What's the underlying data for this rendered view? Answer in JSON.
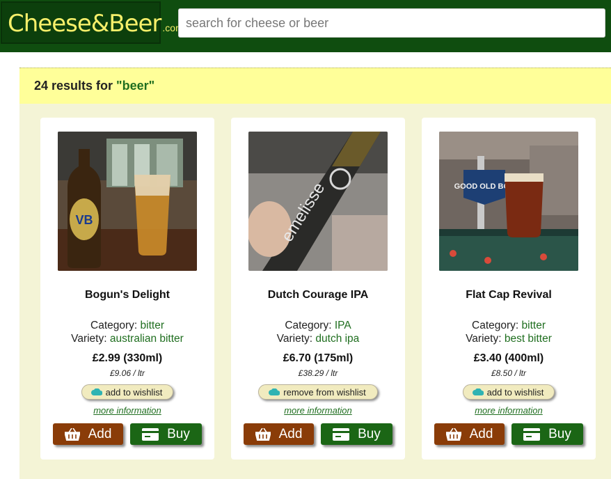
{
  "header": {
    "logo_text": "Cheese&Beer",
    "logo_suffix": ".com",
    "search_placeholder": "search for cheese or beer"
  },
  "results": {
    "text": "24 results for",
    "query": "\"beer\""
  },
  "labels": {
    "category": "Category:",
    "variety": "Variety:",
    "more_info": "more information",
    "add": "Add",
    "buy": "Buy"
  },
  "products": [
    {
      "name": "Bogun's Delight",
      "category": "bitter",
      "variety": "australian bitter",
      "price": "£2.99 (330ml)",
      "unit_price": "£9.06 / ltr",
      "wishlist_label": "add to wishlist",
      "bottle_label": "VB"
    },
    {
      "name": "Dutch Courage IPA",
      "category": "IPA",
      "variety": "dutch ipa",
      "price": "£6.70 (175ml)",
      "unit_price": "£38.29 / ltr",
      "wishlist_label": "remove from wishlist",
      "bottle_label": "emelisse"
    },
    {
      "name": "Flat Cap Revival",
      "category": "bitter",
      "variety": "best bitter",
      "price": "£3.40 (400ml)",
      "unit_price": "£8.50 / ltr",
      "wishlist_label": "add to wishlist",
      "bottle_label": "GOOD OLD BOY"
    }
  ],
  "colors": {
    "header_bg": "#0f4d0f",
    "logo_text": "#f6ef6a",
    "results_bar": "#ffff99",
    "grid_bg": "#f4f4d6",
    "accent_green": "#1f6e1f",
    "add_button": "#8a3c08",
    "buy_button": "#1b6615",
    "wishlist_icon": "#2fb3b3"
  }
}
